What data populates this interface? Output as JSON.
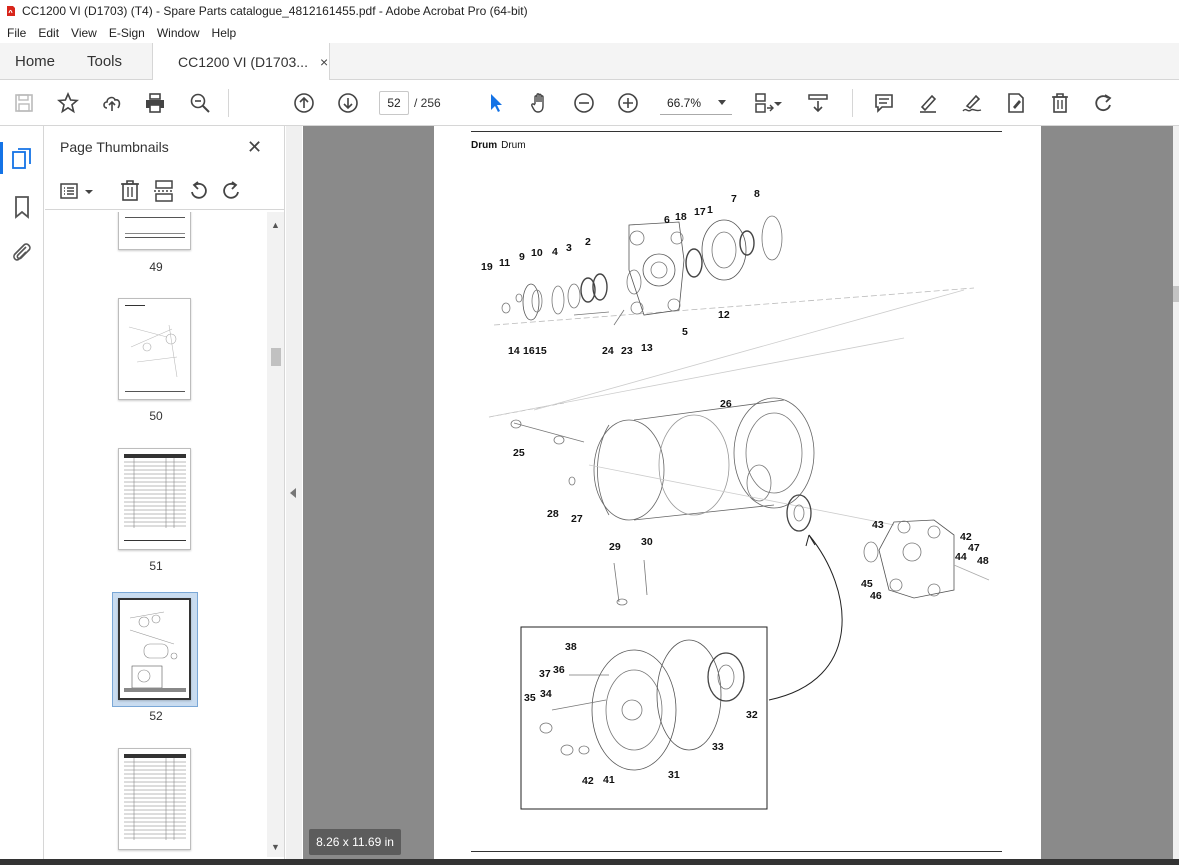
{
  "window": {
    "title": "CC1200 VI (D1703) (T4) - Spare Parts catalogue_4812161455.pdf - Adobe Acrobat Pro (64-bit)"
  },
  "menu": [
    "File",
    "Edit",
    "View",
    "E-Sign",
    "Window",
    "Help"
  ],
  "tabs": {
    "home": "Home",
    "tools": "Tools",
    "document": "CC1200 VI (D1703...",
    "close_glyph": "×"
  },
  "toolbar": {
    "current_page": "52",
    "page_total": "/ 256",
    "zoom": "66.7%",
    "icons": [
      "save-icon",
      "bookmark-star-icon",
      "upload-icon",
      "print-icon",
      "zoom-search-icon",
      "page-up-icon",
      "page-down-icon",
      "select-cursor-icon",
      "hand-icon",
      "zoom-out-icon",
      "zoom-in-icon",
      "page-display-icon",
      "scroll-mode-icon",
      "comment-icon",
      "highlight-icon",
      "sign-icon",
      "fill-sign-icon",
      "delete-icon",
      "rotate-icon"
    ]
  },
  "thumbnail_panel": {
    "title": "Page Thumbnails",
    "close_glyph": "✕",
    "pages": [
      {
        "label": "49"
      },
      {
        "label": "50"
      },
      {
        "label": "51"
      },
      {
        "label": "52",
        "selected": true
      },
      {
        "label": ""
      }
    ]
  },
  "page": {
    "heading_bold": "Drum",
    "heading_normal": "Drum",
    "callouts": [
      "19",
      "11",
      "9",
      "10",
      "4",
      "3",
      "2",
      "6",
      "18",
      "17",
      "1",
      "7",
      "8",
      "12",
      "14",
      "16",
      "15",
      "24",
      "23",
      "13",
      "5",
      "26",
      "25",
      "28",
      "27",
      "29",
      "30",
      "43",
      "42",
      "47",
      "44",
      "48",
      "45",
      "46",
      "38",
      "37",
      "36",
      "35",
      "34",
      "32",
      "33",
      "42",
      "41",
      "31"
    ]
  },
  "status": {
    "page_size": "8.26 x 11.69 in"
  },
  "colors": {
    "accent": "#1473e6",
    "pdf_red": "#d8251b",
    "viewer_bg": "#8a8a8a"
  }
}
